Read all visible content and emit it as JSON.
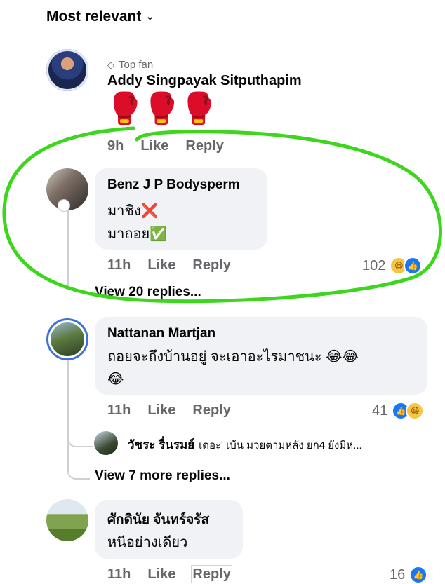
{
  "sort": {
    "label": "Most relevant",
    "icon": "chevron-down-icon"
  },
  "comments": [
    {
      "badge": "Top fan",
      "badge_icon": "diamond-icon",
      "author": "Addy Singpayak Sitputhapim",
      "text": "🥊🥊🥊",
      "time": "9h",
      "like": "Like",
      "reply": "Reply"
    },
    {
      "author": "Benz J P Bodysperm",
      "lines": [
        "มาชิง❌",
        "มาถอย✅"
      ],
      "time": "11h",
      "like": "Like",
      "reply": "Reply",
      "reaction_count": "102",
      "reactions": [
        "haha-icon",
        "like-icon"
      ],
      "view_replies": "View 20 replies..."
    },
    {
      "author": "Nattanan Martjan",
      "lines": [
        "ถอยจะถึงบ้านอยู่ จะเอาอะไรมาชนะ 😂😂",
        "😂"
      ],
      "time": "11h",
      "like": "Like",
      "reply": "Reply",
      "reaction_count": "41",
      "reactions": [
        "like-icon",
        "haha-icon"
      ],
      "nested_reply": {
        "author": "วัชระ รื่นรมย์",
        "text": "เดอะ' เบ้น มวยตามหลัง ยก4 ยังมีห..."
      },
      "view_replies": "View 7 more replies..."
    },
    {
      "author": "ศักดินัย จันทร์จรัส",
      "lines": [
        "หนีอย่างเดียว"
      ],
      "time": "11h",
      "like": "Like",
      "reply": "Reply",
      "reaction_count": "16",
      "reactions": [
        "like-icon"
      ]
    }
  ],
  "colors": {
    "highlight": "#3cd61d",
    "meta": "#65676b",
    "bubble": "#f0f2f5",
    "like": "#1877f2"
  }
}
